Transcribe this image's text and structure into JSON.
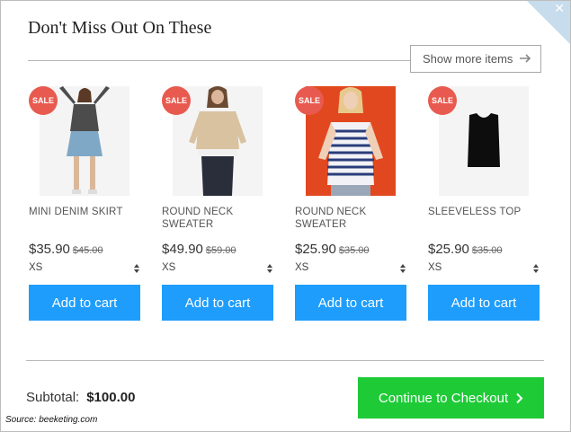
{
  "modal": {
    "title": "Don't Miss Out On These",
    "show_more_label": "Show more items"
  },
  "products": [
    {
      "sale_badge": "SALE",
      "name": "MINI DENIM SKIRT",
      "price": "$35.90",
      "old_price": "$45.00",
      "size": "XS",
      "button_label": "Add to cart"
    },
    {
      "sale_badge": "SALE",
      "name": "ROUND NECK SWEATER",
      "price": "$49.90",
      "old_price": "$59.00",
      "size": "XS",
      "button_label": "Add to cart"
    },
    {
      "sale_badge": "SALE",
      "name": "ROUND NECK SWEATER",
      "price": "$25.90",
      "old_price": "$35.00",
      "size": "XS",
      "button_label": "Add to cart"
    },
    {
      "sale_badge": "SALE",
      "name": "SLEEVELESS TOP",
      "price": "$25.90",
      "old_price": "$35.00",
      "size": "XS",
      "button_label": "Add to cart"
    }
  ],
  "footer": {
    "subtotal_label": "Subtotal:",
    "subtotal_amount": "$100.00",
    "checkout_label": "Continue to Checkout",
    "source": "Source: beeketing.com"
  },
  "colors": {
    "add_to_cart": "#1e9dfc",
    "checkout": "#1ecb37",
    "sale_badge": "#e85a4f",
    "corner": "#c7dcec"
  },
  "icons": {
    "close": "close-icon",
    "show_more": "arrow-right-icon",
    "size_select": "sort-arrows-icon",
    "checkout": "chevron-right-icon"
  }
}
